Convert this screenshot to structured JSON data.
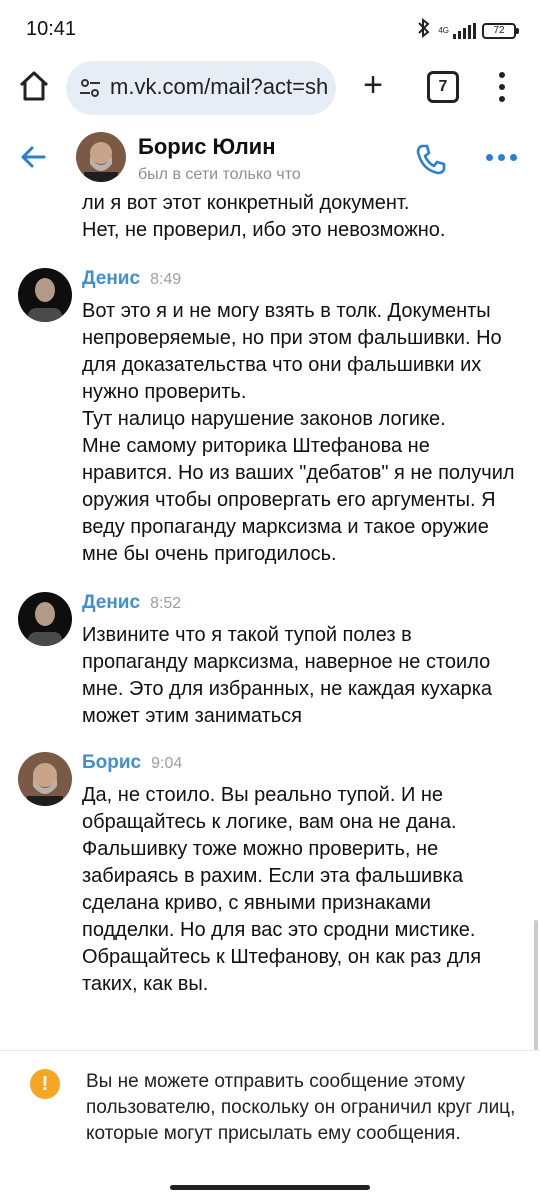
{
  "status_bar": {
    "time": "10:41",
    "network": "4G",
    "battery": "72",
    "icons": [
      "bluetooth-icon",
      "signal-icon",
      "battery-icon"
    ]
  },
  "browser": {
    "url": "m.vk.com/mail?act=sh",
    "tab_count": "7",
    "icons": [
      "home-icon",
      "tune-icon",
      "plus-icon",
      "tabs-icon",
      "kebab-menu-icon"
    ]
  },
  "chat_header": {
    "name": "Борис Юлин",
    "status": "был в сети только что",
    "icons": [
      "back-arrow-icon",
      "phone-icon",
      "more-icon"
    ]
  },
  "continuation_text": "ли я вот этот конкретный документ.\nНет, не проверил, ибо это невозможно.",
  "messages": [
    {
      "author": "Денис",
      "time": "8:49",
      "text": "Вот это я и не могу взять в толк. Документы непроверяемые, но при этом фальшивки. Но для доказательства что они фальшивки их нужно проверить.\nТут налицо нарушение законов логике.\nМне самому риторика Штефанова не нравится. Но из ваших \"дебатов\" я не получил оружия чтобы опровергать его аргументы. Я веду пропаганду марксизма и такое оружие мне бы очень пригодилось."
    },
    {
      "author": "Денис",
      "time": "8:52",
      "text": "Извините что я такой тупой полез в пропаганду марксизма, наверное не стоило мне. Это для избранных, не каждая кухарка может этим заниматься"
    },
    {
      "author": "Борис",
      "time": "9:04",
      "text": "Да, не стоило. Вы реально тупой. И не обращайтесь к логике, вам она не дана. Фальшивку тоже можно проверить, не забираясь в рахим. Если эта фальшивка сделана криво, с явными признаками подделки. Но для вас это сродни мистике. Обращайтесь к Штефанову, он как раз для таких, как вы."
    }
  ],
  "notice": {
    "text": "Вы не можете отправить сообщение этому пользователю, поскольку он ограничил круг лиц, которые могут присылать ему сообщения."
  },
  "colors": {
    "accent": "#3f8fd2",
    "url_bg": "#e6edf5",
    "warning": "#f5a623"
  }
}
